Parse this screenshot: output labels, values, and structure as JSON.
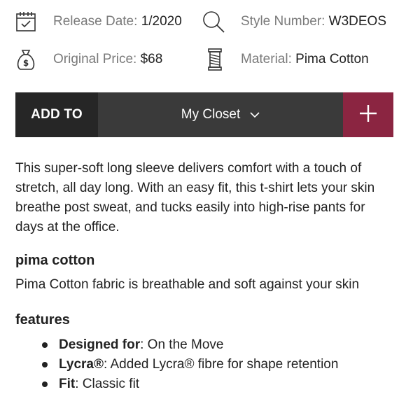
{
  "meta": {
    "release_label": "Release Date:",
    "release_value": "1/2020",
    "style_label": "Style Number:",
    "style_value": "W3DEOS",
    "price_label": "Original Price:",
    "price_value": "$68",
    "material_label": "Material:",
    "material_value": "Pima Cotton"
  },
  "icons": {
    "release": "calendar-icon",
    "style": "search-icon",
    "price": "money-bag-icon",
    "material": "thread-spool-icon",
    "dropdown": "chevron-down-icon",
    "add": "plus-icon"
  },
  "add_bar": {
    "add_to_label": "ADD TO",
    "closet_value": "My Closet",
    "plus_label": "+"
  },
  "description": "This super-soft long sleeve delivers comfort with a touch of stretch, all day long. With an easy fit, this t-shirt lets your skin breathe post sweat, and tucks easily into high-rise pants for days at the office.",
  "fabric": {
    "title": "pima cotton",
    "body": "Pima Cotton fabric is breathable and soft against your skin"
  },
  "features": {
    "title": "features",
    "items": [
      {
        "name": "Designed for",
        "value": ": On the Move"
      },
      {
        "name": "Lycra®",
        "value": ": Added Lycra® fibre for shape retention"
      },
      {
        "name": "Fit",
        "value": ": Classic fit"
      }
    ]
  },
  "colors": {
    "bar_dark": "#262626",
    "bar_mid": "#3a3a3a",
    "accent": "#8b2541",
    "label_gray": "#7a7a7a"
  }
}
